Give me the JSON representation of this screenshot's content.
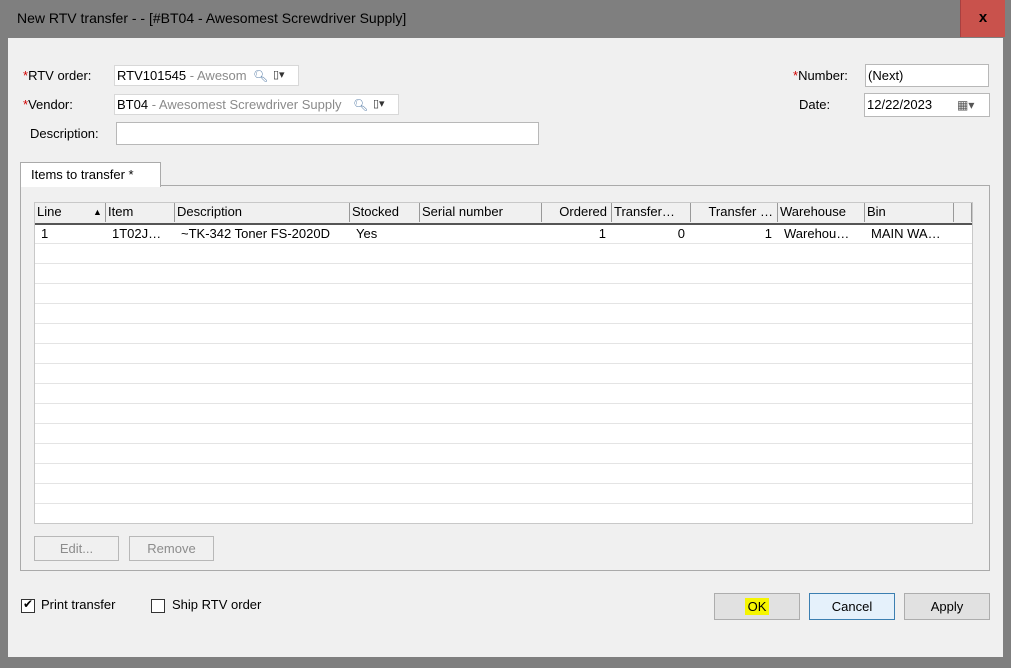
{
  "window": {
    "title": "New RTV transfer -  - [#BT04 - Awesomest Screwdriver Supply]",
    "close_label": "x"
  },
  "header": {
    "rtv_order_label": "RTV order:",
    "rtv_order_value": "RTV101545",
    "rtv_order_desc": " - Awesom",
    "vendor_label": "Vendor:",
    "vendor_value": "BT04",
    "vendor_desc": " - Awesomest Screwdriver Supply",
    "description_label": "Description:",
    "description_value": "",
    "number_label": "Number:",
    "number_value": "(Next)",
    "date_label": "Date:",
    "date_value": "12/22/2023",
    "required_mark": "*"
  },
  "tabs": [
    {
      "label": "Items to transfer  *"
    }
  ],
  "grid": {
    "columns": [
      "Line",
      "Item",
      "Description",
      "Stocked",
      "Serial number",
      "Ordered",
      "Transfer…",
      "Transfer …",
      "Warehouse",
      "Bin"
    ],
    "rows": [
      {
        "line": "1",
        "item": "1T02J…",
        "description": "~TK-342 Toner FS-2020D",
        "stocked": "Yes",
        "serial": "",
        "ordered": "1",
        "transferred": "0",
        "transfer": "1",
        "warehouse": "Warehou…",
        "bin": "MAIN WA…"
      }
    ]
  },
  "actions": {
    "edit": "Edit...",
    "remove": "Remove"
  },
  "footer": {
    "print_transfer_label": "Print transfer",
    "ship_rtv_label": "Ship RTV order",
    "ok": "OK",
    "cancel": "Cancel",
    "apply": "Apply"
  },
  "icons": {
    "lookup": "magnifier-icon",
    "menu": "dropdown-menu-icon",
    "calendar": "calendar-icon",
    "sort": "sort-asc-icon"
  }
}
